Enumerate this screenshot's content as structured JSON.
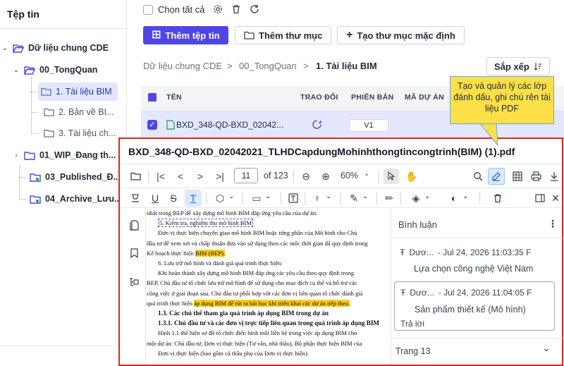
{
  "sidebar": {
    "title": "Tệp tin",
    "tree": [
      {
        "label": "Dữ liệu chung CDE"
      },
      {
        "label": "00_TongQuan"
      },
      {
        "label": "1. Tài liệu BIM"
      },
      {
        "label": "2. Bản vẽ BI..."
      },
      {
        "label": "3. Tài liệu ch..."
      },
      {
        "label": "01_WIP_Đang th..."
      },
      {
        "label": "03_Published_Đ..."
      },
      {
        "label": "04_Archive_Lưu..."
      }
    ]
  },
  "toolbar": {
    "select_all": "Chọn tất cả",
    "add_file": "Thêm tệp tin",
    "add_folder": "Thêm thư mục",
    "create_default": "Tạo thư mục mặc định"
  },
  "breadcrumb": {
    "items": [
      "Dữ liệu chung CDE",
      "00_TongQuan"
    ],
    "current": "1. Tài liệu BIM",
    "separator": ">"
  },
  "sort_label": "Sắp xếp",
  "table": {
    "headers": [
      "TÊN",
      "TRAO ĐỔI",
      "PHIÊN BẢN",
      "MÃ DỰ ÁN"
    ],
    "row": {
      "name": "BXD_348-QD-BXD_02042...",
      "version": "V1"
    }
  },
  "tooltip": "Tạo và quản lý các lớp đánh dấu, ghi chú rên tài liệu PDF",
  "viewer": {
    "file_title": "BXD_348-QD-BXD_02042021_TLHDCapdungMohinhthongtincongtrinh(BIM) (1).pdf",
    "page": "11",
    "of_pages": "of 123",
    "zoom": "60%",
    "doc_lines": [
      {
        "t": "nhất trong BEP để xây dựng mô hình BIM đáp ứng yêu cầu của dự án."
      },
      {
        "t": "5. Kiểm tra, nghiệm thu mô hình BIM",
        "boxed": true
      },
      {
        "t": "Đơn vị thực hiện chuyên giao mô hình BIM hoặc từng phần của Mô hình cho Chủ"
      },
      {
        "t": "đầu tư để xem xét và chấp thuận đưa vào sử dụng theo các mốc thời gian đã quy định trong"
      },
      {
        "t": "Kế hoạch thực hiện",
        "hl": "BIM (BEP).",
        "after": ""
      },
      {
        "t": "6. Lưu trữ mô hình và đánh giá quá trình thực hiện:"
      },
      {
        "t": "Khi hoàn thành xây dựng mô hình BIM đáp ứng các yêu cầu theo quy định trong"
      },
      {
        "t": "BEP, Chủ đầu tư tổ chức lưu trữ mô hình để sử dụng cho mục đích cụ thể và hỗ trợ các"
      },
      {
        "t": "công việc ở giai đoạn sau. Chủ đầu tư phối hợp với các đơn vị liên quan tổ chức đánh giá"
      },
      {
        "t": "quá trình thực hiện",
        "hl": "áp dụng BIM để rút ra bài học khi triển khai các dự án tiếp theo.",
        "after": ""
      },
      {
        "t": "1.3. Các chủ thể tham gia quá trình áp dụng BIM trong dự án",
        "h": true
      },
      {
        "t": "1.3.1. Chủ đầu tư và các đơn vị trực tiếp liên quan trong quá trình áp dụng BIM",
        "h": true
      },
      {
        "t": "Hình 1.1 thể hiện sơ đồ tổ chức điển hình mối liên hệ trong việc áp dụng BIM cho"
      },
      {
        "t": "một dự án: Chủ đầu tư, Đơn vị thực hiện (Tư vấn, nhà thầu), Bộ phận thực hiện BIM của"
      },
      {
        "t": "Đơn vị thực hiện (bao gồm cả thầu phụ của Đơn vị thực hiện)."
      }
    ],
    "comments_title": "Bình luận",
    "comments": [
      {
        "author": "Dươ...",
        "date": "- Jul 24, 2026 11:03:35 F",
        "text": "Lựa chọn công nghệ Việt Nam"
      },
      {
        "author": "Dươ...",
        "date": "- Jul 24, 2026 11:04:05 F",
        "text": "Sản phẩm thiết kế (Mô hình)",
        "reply": "Trả lời"
      }
    ],
    "page_group": "Trang 13"
  },
  "colors": {
    "primary": "#4f46e5",
    "highlight": "#facc15",
    "frame": "#dc2626",
    "tooltip": "#fde047"
  }
}
